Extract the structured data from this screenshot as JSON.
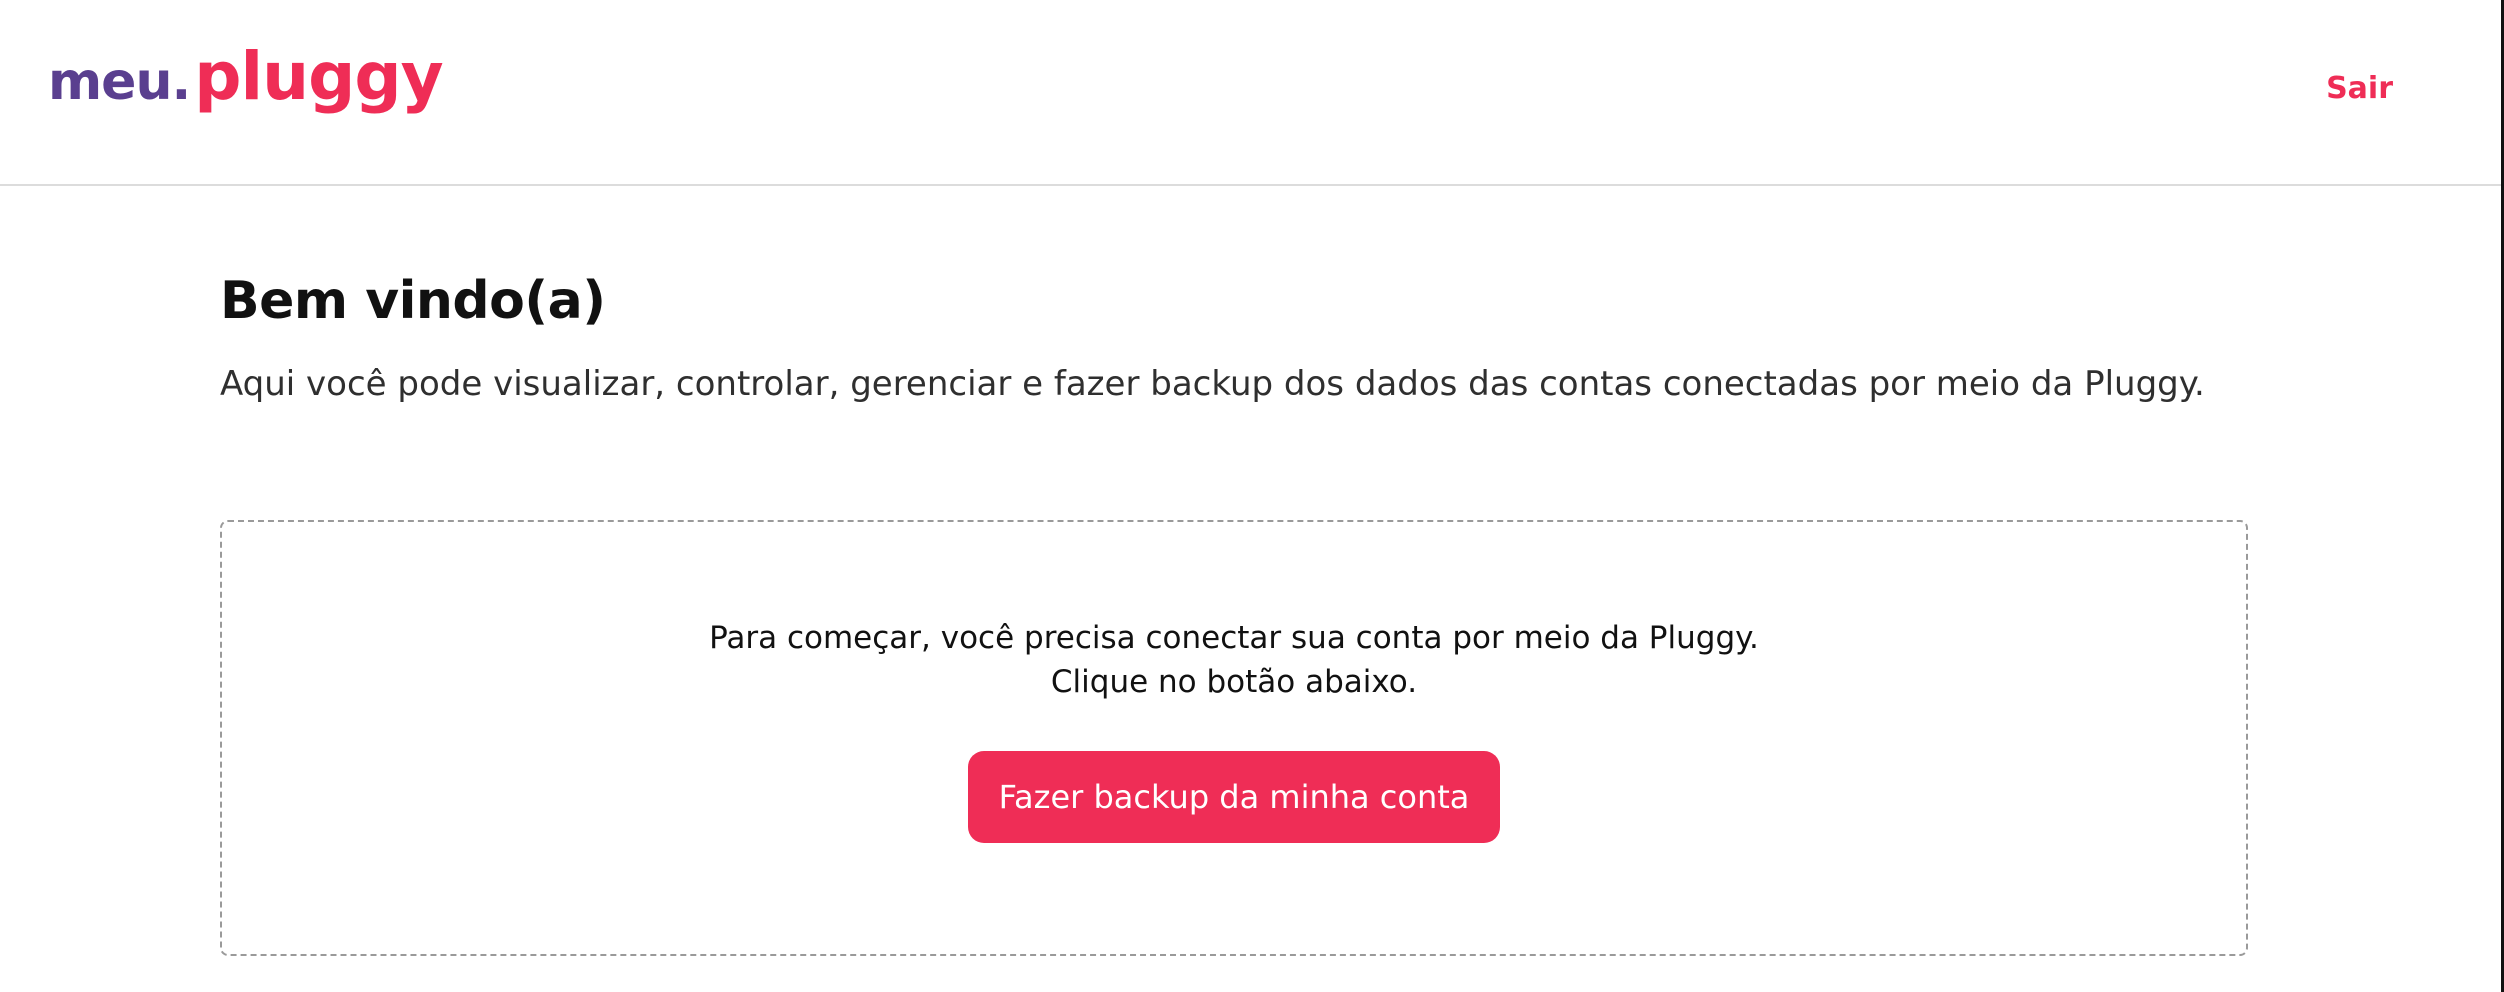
{
  "colors": {
    "brand_purple": "#5a3f8f",
    "brand_red": "#ef2d56",
    "divider": "#dcdcdc",
    "text_primary": "#111111",
    "text_secondary": "#2f2f2f",
    "card_border": "#9a9a9a"
  },
  "header": {
    "logo": {
      "part1": "meu",
      "dot": ".",
      "part2": "pluggy"
    },
    "logout_label": "Sair"
  },
  "main": {
    "title": "Bem vindo(a)",
    "subtitle": "Aqui você pode visualizar, controlar, gerenciar e fazer backup dos dados das contas conectadas por meio da Pluggy.",
    "empty_state": {
      "line1": "Para começar, você precisa conectar sua conta por meio da Pluggy.",
      "line2": "Clique no botão abaixo.",
      "cta_label": "Fazer backup da minha conta"
    }
  }
}
